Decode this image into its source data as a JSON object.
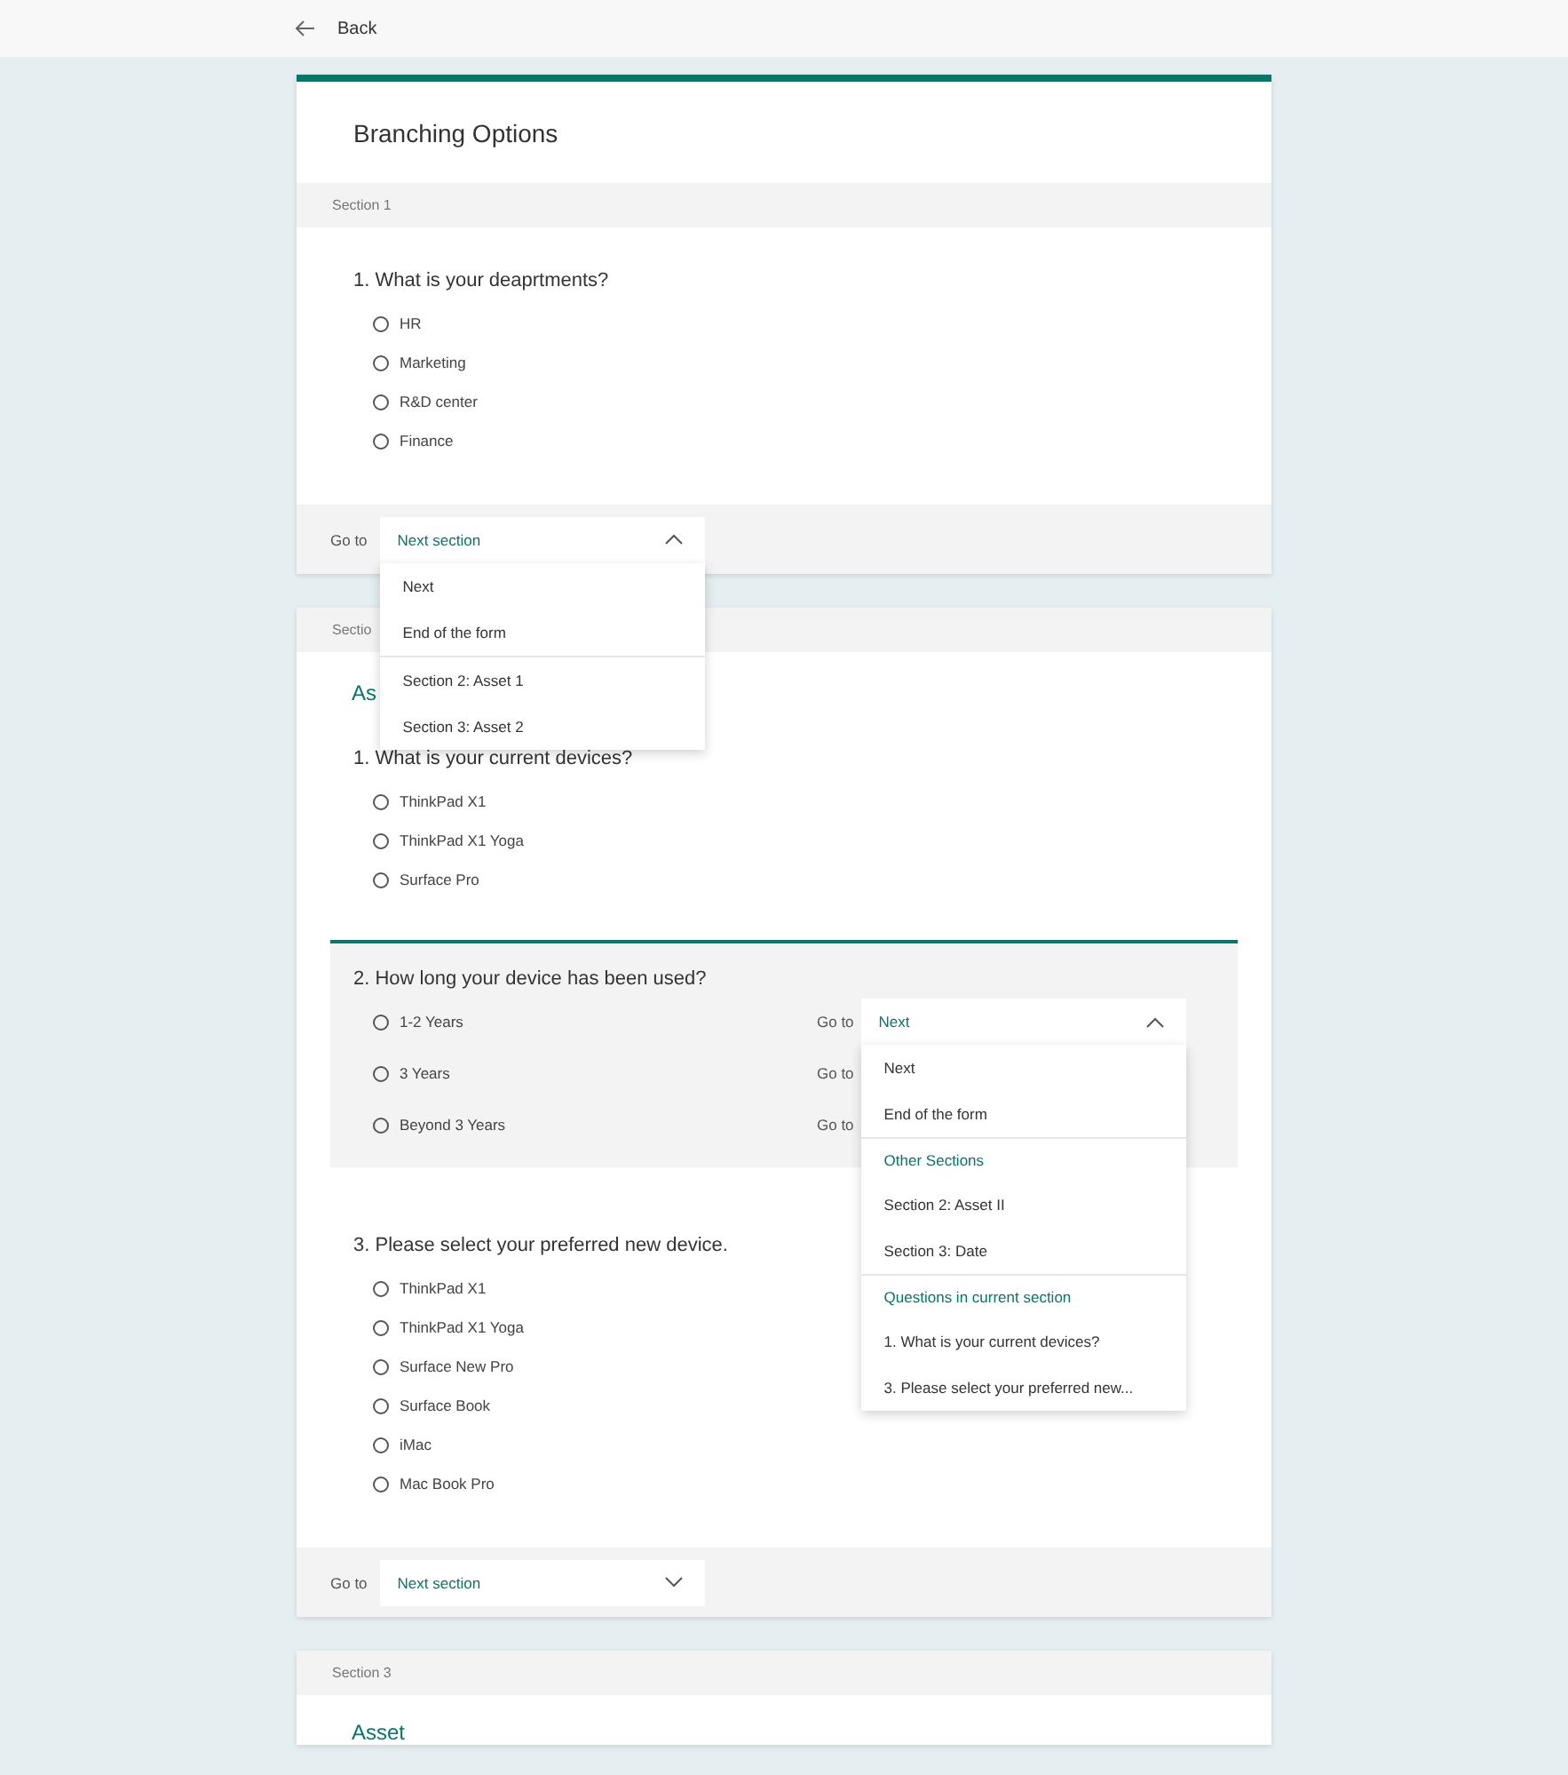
{
  "back": "Back",
  "form_title": "Branching Options",
  "sections": [
    {
      "header": "Section 1",
      "questions": [
        {
          "text": "1. What is your deaprtments?",
          "highlighted": false,
          "options": [
            {
              "label": "HR",
              "selected": false
            },
            {
              "label": "Marketing",
              "selected": false
            },
            {
              "label": "R&D center",
              "selected": false
            },
            {
              "label": "Finance",
              "selected": false
            }
          ]
        }
      ],
      "footer": {
        "label": "Go to",
        "dropdown": {
          "value": "Next section",
          "expanded": true,
          "groups": [
            {
              "items": [
                "Next",
                "End of the form"
              ]
            },
            {
              "items": [
                "Section 2: Asset 1",
                "Section 3: Asset 2"
              ]
            }
          ]
        }
      }
    },
    {
      "header": "Sectio",
      "title": "As",
      "questions": [
        {
          "text": "1. What is your current devices?",
          "highlighted": false,
          "options": [
            {
              "label": "ThinkPad X1",
              "selected": false
            },
            {
              "label": "ThinkPad X1 Yoga",
              "selected": false
            },
            {
              "label": "Surface Pro",
              "selected": false
            }
          ]
        },
        {
          "text": "2. How long your device has been used?",
          "highlighted": true,
          "options": [
            {
              "label": "1-2 Years",
              "selected": false,
              "branch": {
                "label": "Go to",
                "dropdown": {
                  "value": "Next",
                  "expanded": true,
                  "groups": [
                    {
                      "items": [
                        "Next",
                        "End of the form"
                      ]
                    },
                    {
                      "heading": "Other Sections",
                      "items": [
                        "Section 2: Asset II",
                        "Section 3: Date"
                      ]
                    },
                    {
                      "heading": "Questions in current section",
                      "items": [
                        "1. What is your current devices?",
                        "3. Please select your preferred new..."
                      ]
                    }
                  ]
                }
              }
            },
            {
              "label": "3 Years",
              "selected": false,
              "branch": {
                "label": "Go to"
              }
            },
            {
              "label": "Beyond 3 Years",
              "selected": false,
              "branch": {
                "label": "Go to"
              }
            }
          ]
        },
        {
          "text": "3. Please select your preferred new device.",
          "highlighted": false,
          "options": [
            {
              "label": "ThinkPad X1",
              "selected": false
            },
            {
              "label": "ThinkPad X1 Yoga",
              "selected": false
            },
            {
              "label": "Surface New Pro",
              "selected": false
            },
            {
              "label": "Surface Book",
              "selected": false
            },
            {
              "label": "iMac",
              "selected": false
            },
            {
              "label": "Mac Book Pro",
              "selected": false
            }
          ]
        }
      ],
      "footer": {
        "label": "Go to",
        "dropdown": {
          "value": "Next section",
          "expanded": false
        }
      }
    },
    {
      "header": "Section 3",
      "title": "Asset"
    }
  ]
}
